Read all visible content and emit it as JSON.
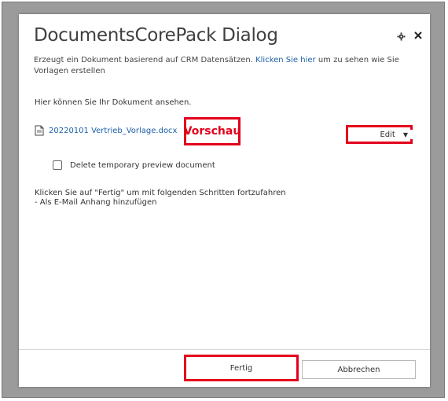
{
  "dialog": {
    "title": "DocumentsCorePack Dialog",
    "subtitle_prefix": "Erzeugt ein Dokument basierend auf CRM Datensätzen.",
    "subtitle_link": "Klicken Sie hier",
    "subtitle_suffix": "um zu sehen wie Sie Vorlagen erstellen",
    "intro": "Hier können Sie Ihr Dokument ansehen.",
    "file_name": "20220101 Vertrieb_Vorlage.docx",
    "preview_annotation": "Vorschau",
    "edit_label": "Edit",
    "checkbox_label": "Delete temporary preview document",
    "checkbox_checked": false,
    "info_line1": "Klicken Sie auf \"Fertig\" um mit folgenden Schritten fortzufahren",
    "info_line2": "- Als E-Mail Anhang hinzufügen",
    "finish_label": "Fertig",
    "cancel_label": "Abbrechen"
  },
  "icons": {
    "settings": "gear-icon",
    "close": "close-icon",
    "document": "document-icon",
    "dropdown": "caret-down-icon"
  },
  "colors": {
    "link": "#1a5fa8",
    "highlight": "#e3001b"
  }
}
